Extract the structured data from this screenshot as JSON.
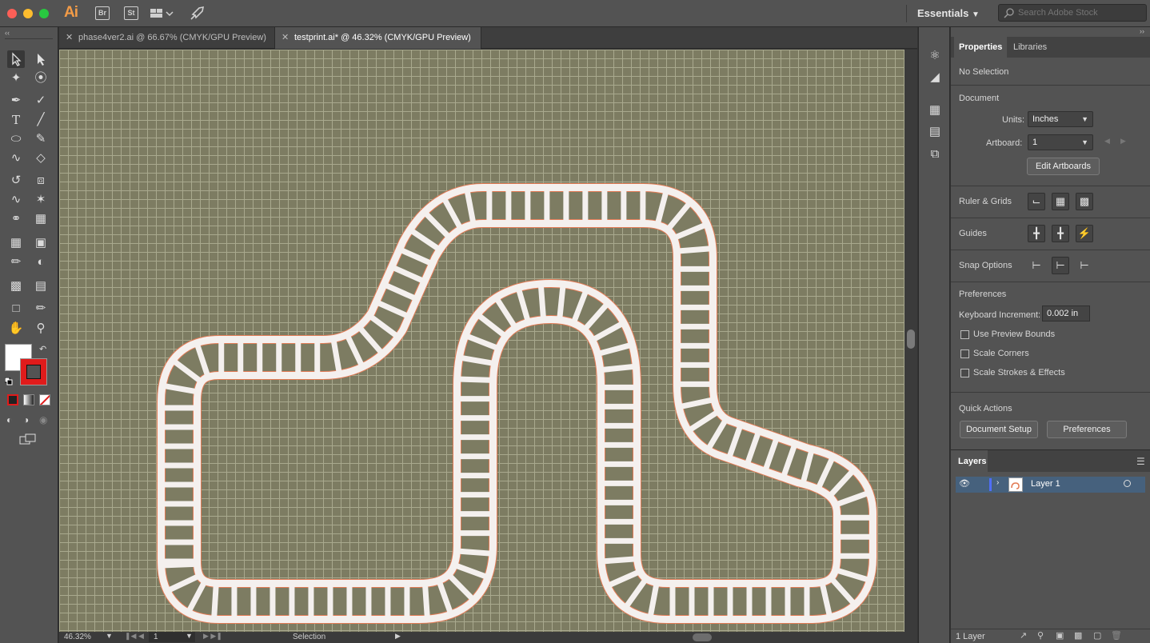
{
  "app": {
    "name": "Ai",
    "bridge_icon": "Br",
    "stock_icon": "St",
    "workspace": "Essentials",
    "search_placeholder": "Search Adobe Stock"
  },
  "tabs": [
    {
      "label": "phase4ver2.ai @ 66.67% (CMYK/GPU Preview)",
      "active": false
    },
    {
      "label": "testprint.ai* @ 46.32% (CMYK/GPU Preview)",
      "active": true
    }
  ],
  "status": {
    "zoom": "46.32%",
    "artboard": "1",
    "tool": "Selection"
  },
  "properties": {
    "tab_properties": "Properties",
    "tab_libraries": "Libraries",
    "no_selection": "No Selection",
    "document_section": "Document",
    "units_label": "Units:",
    "units_value": "Inches",
    "artboard_label": "Artboard:",
    "artboard_value": "1",
    "edit_artboards": "Edit Artboards",
    "ruler_grids": "Ruler & Grids",
    "guides": "Guides",
    "snap_options": "Snap Options",
    "preferences_section": "Preferences",
    "keyboard_increment_label": "Keyboard Increment:",
    "keyboard_increment_value": "0.002 in",
    "use_preview_bounds": "Use Preview Bounds",
    "scale_corners": "Scale Corners",
    "scale_strokes": "Scale Strokes & Effects",
    "quick_actions": "Quick Actions",
    "document_setup": "Document Setup",
    "preferences_button": "Preferences"
  },
  "layers": {
    "title": "Layers",
    "items": [
      {
        "name": "Layer 1",
        "visible": true
      }
    ],
    "count": "1 Layer"
  },
  "colors": {
    "accent_orange": "#f29b47",
    "stroke_red": "#e01b1b",
    "canvas_bg": "#7d7c62",
    "track_fill": "#f4f0ee",
    "track_edge": "#e27b55",
    "selected_layer": "#46617d"
  }
}
